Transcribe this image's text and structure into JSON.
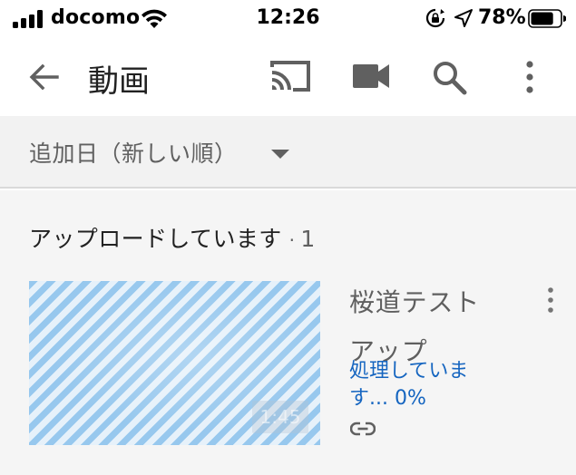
{
  "status_bar": {
    "carrier": "docomo",
    "time": "12:26",
    "battery_percent": "78%",
    "battery_level": 0.78
  },
  "app_bar": {
    "title": "動画",
    "icons": [
      "back-arrow-icon",
      "cast-icon",
      "video-camera-icon",
      "search-icon",
      "more-vert-icon"
    ]
  },
  "sort": {
    "label": "追加日（新しい順）",
    "icon": "caret-down-icon"
  },
  "uploading_section": {
    "title": "アップロードしています",
    "separator": "·",
    "count": "1"
  },
  "video": {
    "title": "桜道テスト アップ",
    "status": "処理しています... 0%",
    "duration": "1:45",
    "icons": [
      "link-icon",
      "more-vert-icon"
    ]
  },
  "colors": {
    "link_blue": "#1565c0",
    "sort_bar_bg": "#f2f2f2",
    "content_bg": "#f5f5f5",
    "icon_gray": "#606060"
  }
}
